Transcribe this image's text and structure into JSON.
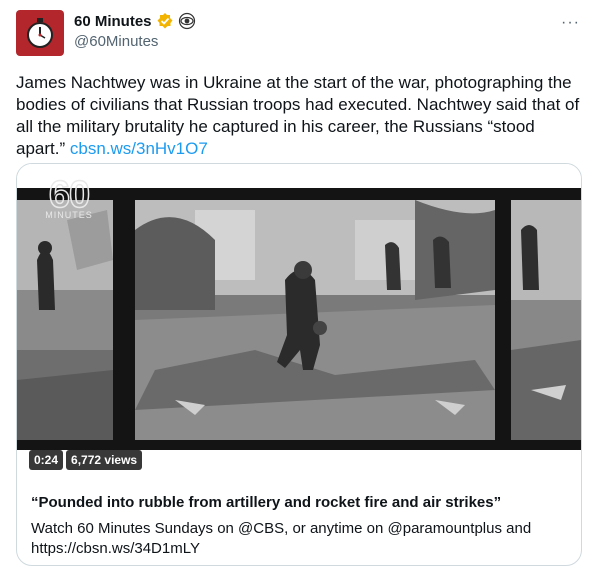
{
  "author": {
    "display_name": "60 Minutes",
    "handle": "@60Minutes",
    "verified_badge_color": "#f2b400"
  },
  "menu": {
    "more_label": "···"
  },
  "tweet": {
    "text": "James Nachtwey was in Ukraine at the start of the war, photographing the bodies of civilians that Russian troops had executed. Nachtwey said that of all the military brutality he captured in his career, the Russians “stood apart.” ",
    "link": "cbsn.ws/3nHv1O7",
    "link_color": "#1d9bf0"
  },
  "media": {
    "logo_number": "60",
    "logo_word": "MINUTES",
    "duration": "0:24",
    "views": "6,772 views"
  },
  "card": {
    "title": "“Pounded into rubble from artillery and rocket fire and air strikes”",
    "description": "Watch 60 Minutes Sundays on @CBS, or anytime on @paramountplus and https://cbsn.ws/34D1mLY"
  }
}
